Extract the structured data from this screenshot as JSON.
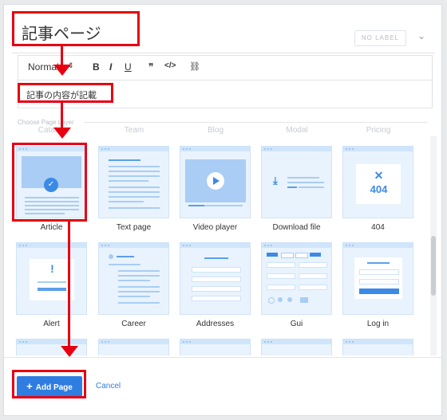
{
  "title": "記事ページ",
  "no_label": "NO LABEL",
  "toolbar": {
    "format": "Normal",
    "bold": "B",
    "italic": "I",
    "underline": "U",
    "quote": "❞",
    "code": "</>",
    "link": "🔗"
  },
  "content": "記事の内容が記載",
  "choose_label": "Choose Page Layer",
  "tabs": [
    "Catalog",
    "Team",
    "Blog",
    "Modal",
    "Pricing"
  ],
  "cards": [
    {
      "label": "Article"
    },
    {
      "label": "Text page"
    },
    {
      "label": "Video player"
    },
    {
      "label": "Download file"
    },
    {
      "label": "404"
    },
    {
      "label": "Alert"
    },
    {
      "label": "Career"
    },
    {
      "label": "Addresses"
    },
    {
      "label": "Gui"
    },
    {
      "label": "Log in"
    }
  ],
  "thumb_404": "404",
  "thumb_x": "✕",
  "thumb_alert": "!",
  "add_page": "Add Page",
  "add_icon": "+",
  "cancel": "Cancel",
  "colors": {
    "accent": "#2f7de1",
    "annotation": "#e60012",
    "thumb_bg": "#e9f3fd"
  }
}
